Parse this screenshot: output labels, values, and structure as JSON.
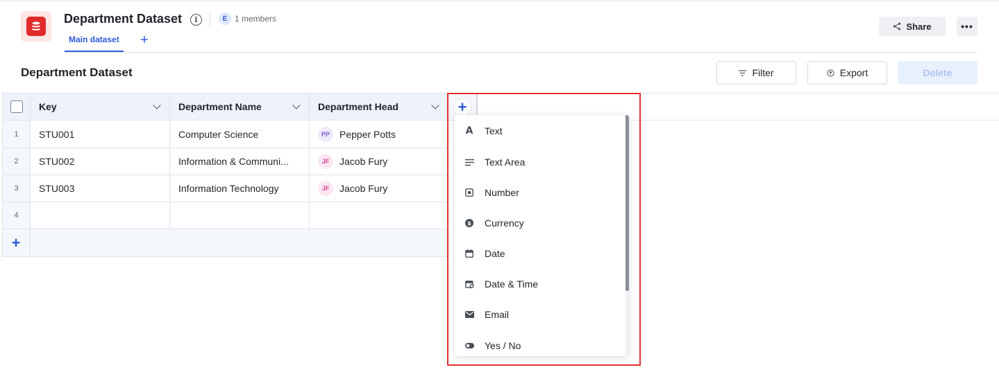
{
  "header": {
    "title": "Department Dataset",
    "members_avatar": "E",
    "members_text": "1 members",
    "tabs": [
      {
        "label": "Main dataset",
        "active": true
      }
    ],
    "share_label": "Share",
    "more_label": "•••"
  },
  "toolbar": {
    "section_title": "Department Dataset",
    "filter_label": "Filter",
    "export_label": "Export",
    "delete_label": "Delete"
  },
  "table": {
    "columns": [
      "Key",
      "Department Name",
      "Department Head"
    ],
    "rows": [
      {
        "index": "1",
        "key": "STU001",
        "department_name": "Computer Science",
        "head_initials": "PP",
        "head": "Pepper Potts"
      },
      {
        "index": "2",
        "key": "STU002",
        "department_name": "Information & Communi...",
        "head_initials": "JF",
        "head": "Jacob Fury"
      },
      {
        "index": "3",
        "key": "STU003",
        "department_name": "Information Technology",
        "head_initials": "JF",
        "head": "Jacob Fury"
      },
      {
        "index": "4",
        "key": "",
        "department_name": "",
        "head_initials": "",
        "head": ""
      }
    ]
  },
  "column_type_menu": {
    "items": [
      {
        "label": "Text",
        "icon": "text-icon"
      },
      {
        "label": "Text Area",
        "icon": "text-area-icon"
      },
      {
        "label": "Number",
        "icon": "number-icon"
      },
      {
        "label": "Currency",
        "icon": "currency-icon"
      },
      {
        "label": "Date",
        "icon": "calendar-icon"
      },
      {
        "label": "Date & Time",
        "icon": "calendar-clock-icon"
      },
      {
        "label": "Email",
        "icon": "envelope-icon"
      },
      {
        "label": "Yes / No",
        "icon": "toggle-icon"
      }
    ]
  },
  "colors": {
    "accent": "#2f5bd8",
    "logo": "#e12b2b",
    "highlight_frame": "#e03030"
  }
}
